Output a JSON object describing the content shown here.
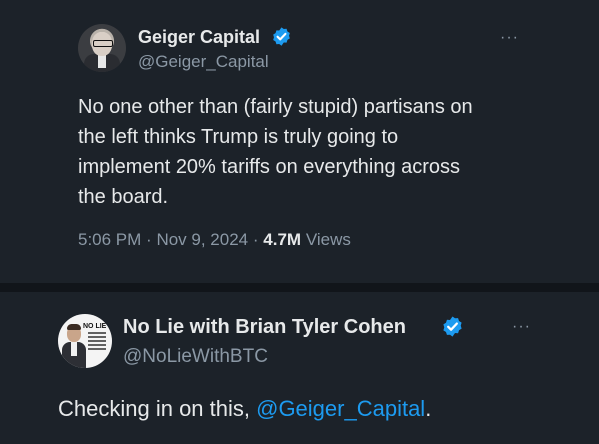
{
  "quoted_tweet": {
    "author_name": "Geiger Capital",
    "handle": "@Geiger_Capital",
    "text_lines": [
      "No one other than (fairly stupid) partisans on",
      "the left thinks Trump is truly going to",
      "implement 20% tariffs on everything across",
      "the board."
    ],
    "time": "5:06 PM",
    "date": "Nov 9, 2024",
    "views_count": "4.7M",
    "views_label": "Views",
    "separator": "·",
    "more_glyph": "···",
    "verified_icon": "verified-badge-icon"
  },
  "reply_tweet": {
    "author_name": "No Lie with Brian Tyler Cohen",
    "handle": "@NoLieWithBTC",
    "text_prefix": "Checking in on this, ",
    "mention": "@Geiger_Capital",
    "text_suffix": ".",
    "avatar_logo_text": "NO LIE",
    "more_glyph": "···",
    "verified_icon": "verified-badge-icon"
  },
  "colors": {
    "background": "#1c2229",
    "text": "#e7e9ea",
    "muted": "#8b98a5",
    "accent": "#1d9bf0"
  }
}
